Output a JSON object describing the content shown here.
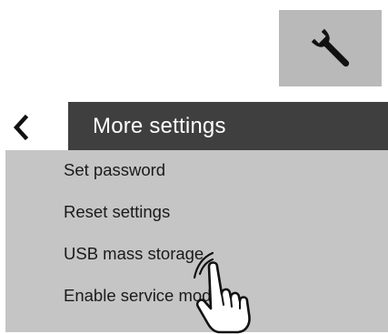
{
  "tool_tile": {
    "icon": "wrench-icon",
    "background": "#b9b9b9"
  },
  "back_button": {
    "icon": "chevron-left-icon"
  },
  "header": {
    "title": "More settings",
    "background": "#3f3f3f"
  },
  "menu": {
    "background": "#c5c5c5",
    "items": [
      {
        "label": "Set password"
      },
      {
        "label": "Reset settings"
      },
      {
        "label": "USB mass storage"
      },
      {
        "label": "Enable service mode"
      }
    ]
  },
  "pointer": {
    "icon": "hand-pointer-icon"
  }
}
